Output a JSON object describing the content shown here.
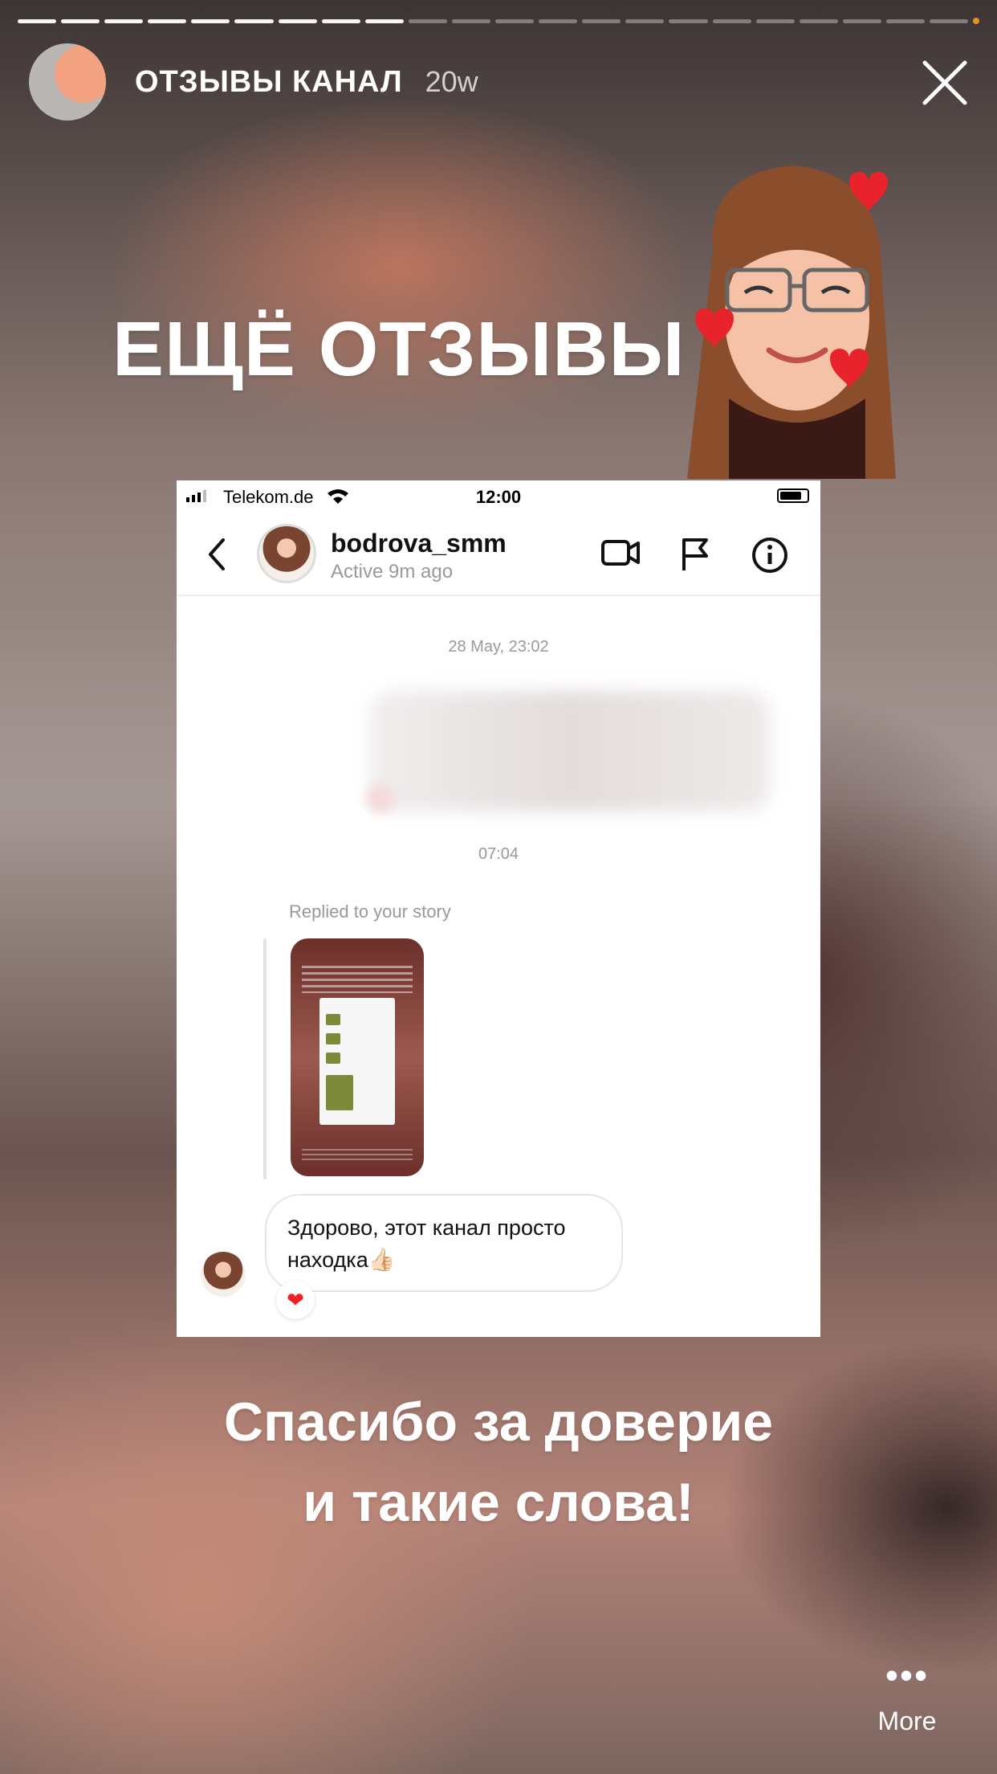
{
  "story": {
    "progress_total": 22,
    "progress_done": 9,
    "progress_indicator_color": "#e8902e",
    "channel_name": "ОТЗЫВЫ КАНАЛ",
    "age": "20w",
    "title": "ЕЩЁ ОТЗЫВЫ",
    "caption_line1": "Спасибо за доверие",
    "caption_line2": "и такие слова!",
    "more_label": "More"
  },
  "screenshot": {
    "status_bar": {
      "carrier": "Telekom.de",
      "time": "12:00"
    },
    "chat_header": {
      "username": "bodrova_smm",
      "status": "Active 9m ago"
    },
    "timestamp1": "28 May, 23:02",
    "timestamp2": "07:04",
    "replied_label": "Replied to your story",
    "message": "Здорово, этот канал просто находка👍🏻",
    "reaction": "❤"
  },
  "icons": [
    "close-icon",
    "back-chevron-icon",
    "video-call-icon",
    "flag-icon",
    "info-icon",
    "more-dots-icon",
    "wifi-icon",
    "battery-icon"
  ]
}
